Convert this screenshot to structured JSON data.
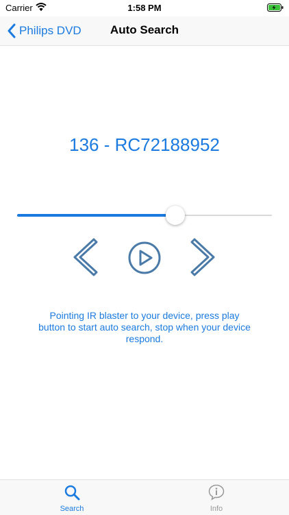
{
  "status_bar": {
    "carrier": "Carrier",
    "time": "1:58 PM",
    "wifi_icon": "wifi-icon",
    "battery_icon": "battery-charging-icon"
  },
  "nav_bar": {
    "back_label": "Philips DVD",
    "title": "Auto Search",
    "back_icon": "chevron-left-icon"
  },
  "search": {
    "code": "136 - RC72188952",
    "progress": 0.62,
    "instructions": "Pointing IR blaster to your device, press play button to start auto search, stop when your device respond."
  },
  "controls": {
    "previous_icon": "chevron-left-icon",
    "play_icon": "play-circle-icon",
    "next_icon": "chevron-right-icon"
  },
  "tab_bar": {
    "tabs": [
      {
        "label": "Search",
        "icon": "search-icon",
        "active": true
      },
      {
        "label": "Info",
        "icon": "info-icon",
        "active": false
      }
    ]
  },
  "colors": {
    "accent": "#1a7ae0",
    "control_stroke": "#4a7aa8",
    "inactive": "#999999"
  }
}
